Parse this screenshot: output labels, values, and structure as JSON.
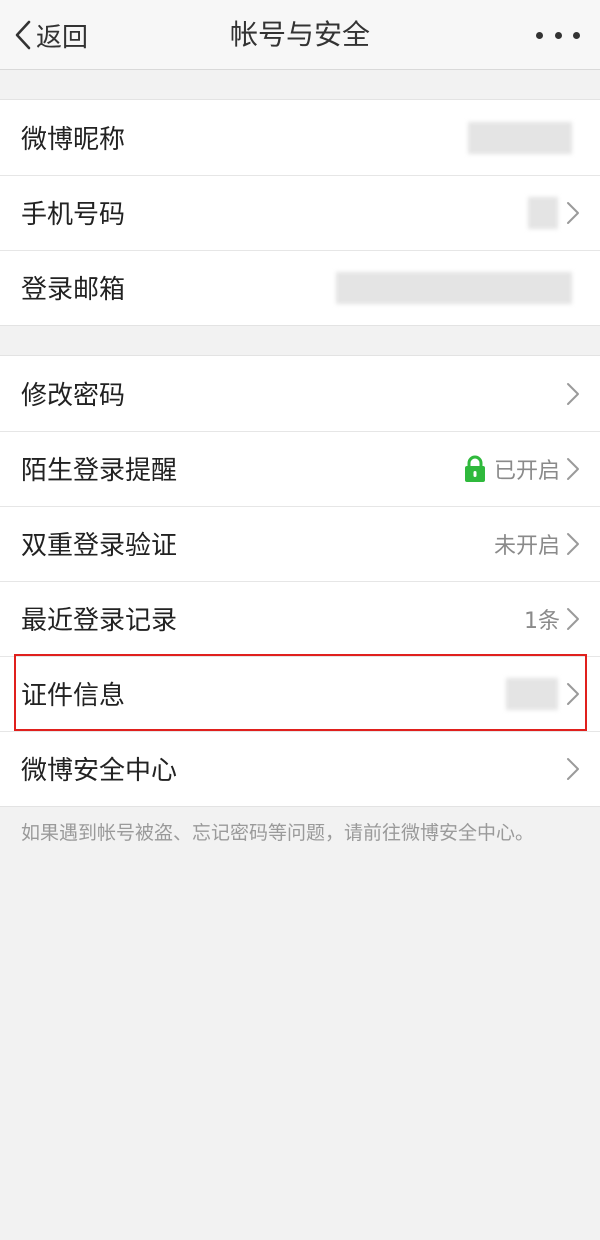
{
  "header": {
    "back_label": "返回",
    "title": "帐号与安全"
  },
  "group1": {
    "items": [
      {
        "label": "微博昵称"
      },
      {
        "label": "手机号码"
      },
      {
        "label": "登录邮箱"
      }
    ]
  },
  "group2": {
    "items": [
      {
        "label": "修改密码",
        "value": ""
      },
      {
        "label": "陌生登录提醒",
        "value": "已开启"
      },
      {
        "label": "双重登录验证",
        "value": "未开启"
      },
      {
        "label": "最近登录记录",
        "value": "1条"
      },
      {
        "label": "证件信息",
        "value": ""
      },
      {
        "label": "微博安全中心",
        "value": ""
      }
    ]
  },
  "footer": {
    "note": "如果遇到帐号被盗、忘记密码等问题，请前往微博安全中心。"
  },
  "colors": {
    "lock_icon": "#2fb93c",
    "highlight_border": "#e0201d",
    "background": "#f2f2f2"
  }
}
